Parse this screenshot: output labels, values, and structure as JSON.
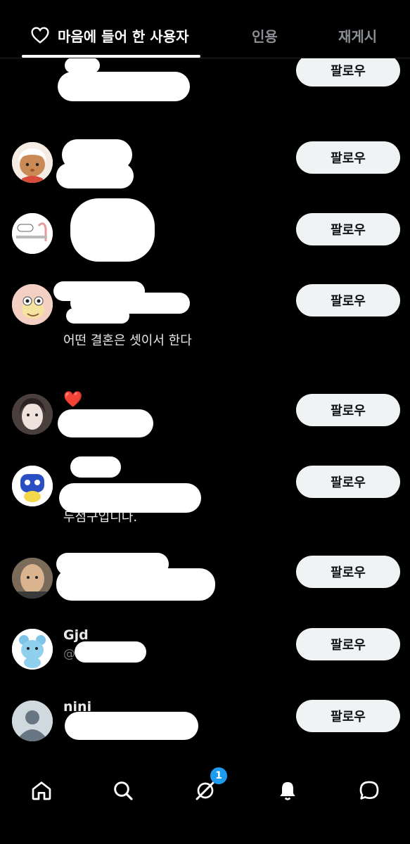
{
  "tabs": {
    "liked_by": "마음에 들어 한 사용자",
    "quotes": "인용",
    "reposts": "재게시"
  },
  "follow_label": "팔로우",
  "users": [
    {
      "name": "",
      "handle": "",
      "bio": ""
    },
    {
      "name": "",
      "handle": "",
      "bio": ""
    },
    {
      "name": "",
      "handle": "",
      "bio": ""
    },
    {
      "name": "",
      "handle": "",
      "bio": "어떤 결혼은 셋이서 한다"
    },
    {
      "name": "❤️",
      "handle": "",
      "bio": ""
    },
    {
      "name": "",
      "handle": "",
      "bio": "두점구입니다."
    },
    {
      "name": "",
      "handle": "",
      "bio": ""
    },
    {
      "name": "Gjd",
      "handle": "@",
      "bio": ""
    },
    {
      "name": "nini",
      "handle": "",
      "bio": ""
    }
  ],
  "bottom_nav": {
    "items": [
      "home-icon",
      "search-icon",
      "grok-icon",
      "notifications-icon",
      "messages-icon"
    ],
    "badge": "1"
  },
  "colors": {
    "background": "#000000",
    "button_bg": "#eff3f4",
    "badge": "#1d9bf0",
    "muted": "#71767b"
  }
}
